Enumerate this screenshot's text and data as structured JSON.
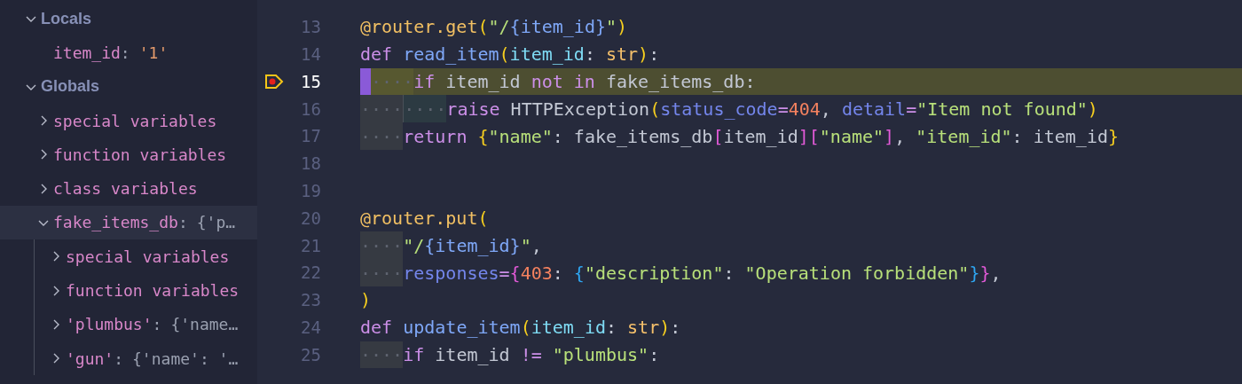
{
  "variables": [
    {
      "label": "Locals",
      "kind": "scope",
      "expanded": true,
      "selected": false,
      "children": [
        {
          "name": "item_id",
          "sep": ":",
          "value": "'1'",
          "kind": "leaf",
          "selected": false
        }
      ]
    },
    {
      "label": "Globals",
      "kind": "scope",
      "expanded": true,
      "selected": false,
      "children": [
        {
          "name": "special variables",
          "kind": "node",
          "expanded": false,
          "selected": false
        },
        {
          "name": "function variables",
          "kind": "node",
          "expanded": false,
          "selected": false
        },
        {
          "name": "class variables",
          "kind": "node",
          "expanded": false,
          "selected": false
        },
        {
          "name": "fake_items_db",
          "sep": ":",
          "value": "{'p…",
          "kind": "node",
          "expanded": true,
          "selected": true,
          "children": [
            {
              "name": "special variables",
              "kind": "node",
              "expanded": false,
              "selected": false
            },
            {
              "name": "function variables",
              "kind": "node",
              "expanded": false,
              "selected": false
            },
            {
              "name": "'plumbus'",
              "sep": ":",
              "value": "{'name…",
              "kind": "node",
              "expanded": false,
              "selected": false
            },
            {
              "name": "'gun'",
              "sep": ":",
              "value": "{'name': '…",
              "kind": "node",
              "expanded": false,
              "selected": false
            }
          ]
        }
      ]
    }
  ],
  "editor": {
    "lines": [
      {
        "number": "13",
        "current": false,
        "breakpoint": false,
        "tokens": [
          {
            "text": "@router.get",
            "kind": "deco"
          },
          {
            "text": "(",
            "kind": "paren"
          },
          {
            "text": "\"/",
            "kind": "str"
          },
          {
            "text": "{item_id}",
            "kind": "fn"
          },
          {
            "text": "\"",
            "kind": "str"
          },
          {
            "text": ")",
            "kind": "paren"
          }
        ]
      },
      {
        "number": "14",
        "current": false,
        "breakpoint": false,
        "tokens": [
          {
            "text": "def ",
            "kind": "kw"
          },
          {
            "text": "read_item",
            "kind": "fn"
          },
          {
            "text": "(",
            "kind": "paren"
          },
          {
            "text": "item_id",
            "kind": "param"
          },
          {
            "text": ": ",
            "kind": "plain"
          },
          {
            "text": "str",
            "kind": "type"
          },
          {
            "text": ")",
            "kind": "paren"
          },
          {
            "text": ":",
            "kind": "plain"
          }
        ]
      },
      {
        "number": "15",
        "current": true,
        "breakpoint": true,
        "tokens": [
          {
            "text": "····",
            "kind": "ws-mark"
          },
          {
            "text": "if ",
            "kind": "kw"
          },
          {
            "text": "item_id ",
            "kind": "plain"
          },
          {
            "text": "not in ",
            "kind": "kw"
          },
          {
            "text": "fake_items_db:",
            "kind": "plain"
          }
        ]
      },
      {
        "number": "16",
        "current": false,
        "breakpoint": false,
        "tokens": [
          {
            "text": "····",
            "kind": "ws"
          },
          {
            "text": "····",
            "kind": "ws2"
          },
          {
            "text": "raise ",
            "kind": "kw"
          },
          {
            "text": "HTTPException",
            "kind": "plain"
          },
          {
            "text": "(",
            "kind": "paren"
          },
          {
            "text": "status_code",
            "kind": "kwarg"
          },
          {
            "text": "=",
            "kind": "kw"
          },
          {
            "text": "404",
            "kind": "num"
          },
          {
            "text": ", ",
            "kind": "plain"
          },
          {
            "text": "detail",
            "kind": "kwarg"
          },
          {
            "text": "=",
            "kind": "kw"
          },
          {
            "text": "\"Item not found\"",
            "kind": "str"
          },
          {
            "text": ")",
            "kind": "paren"
          }
        ]
      },
      {
        "number": "17",
        "current": false,
        "breakpoint": false,
        "tokens": [
          {
            "text": "····",
            "kind": "ws"
          },
          {
            "text": "return ",
            "kind": "kw"
          },
          {
            "text": "{",
            "kind": "paren"
          },
          {
            "text": "\"name\"",
            "kind": "str"
          },
          {
            "text": ": fake_items_db",
            "kind": "plain"
          },
          {
            "text": "[",
            "kind": "bracket"
          },
          {
            "text": "item_id",
            "kind": "plain"
          },
          {
            "text": "][",
            "kind": "bracket"
          },
          {
            "text": "\"name\"",
            "kind": "str"
          },
          {
            "text": "]",
            "kind": "bracket"
          },
          {
            "text": ", ",
            "kind": "plain"
          },
          {
            "text": "\"item_id\"",
            "kind": "str"
          },
          {
            "text": ": item_id",
            "kind": "plain"
          },
          {
            "text": "}",
            "kind": "paren"
          }
        ]
      },
      {
        "number": "18",
        "current": false,
        "breakpoint": false
      },
      {
        "number": "19",
        "current": false,
        "breakpoint": false
      },
      {
        "number": "20",
        "current": false,
        "breakpoint": false,
        "tokens": [
          {
            "text": "@router.put",
            "kind": "deco"
          },
          {
            "text": "(",
            "kind": "paren"
          }
        ]
      },
      {
        "number": "21",
        "current": false,
        "breakpoint": false,
        "tokens": [
          {
            "text": "····",
            "kind": "ws"
          },
          {
            "text": "\"/",
            "kind": "str"
          },
          {
            "text": "{item_id}",
            "kind": "fn"
          },
          {
            "text": "\"",
            "kind": "str"
          },
          {
            "text": ",",
            "kind": "plain"
          }
        ]
      },
      {
        "number": "22",
        "current": false,
        "breakpoint": false,
        "tokens": [
          {
            "text": "····",
            "kind": "ws"
          },
          {
            "text": "responses",
            "kind": "kwarg"
          },
          {
            "text": "=",
            "kind": "kw"
          },
          {
            "text": "{",
            "kind": "bracket"
          },
          {
            "text": "403",
            "kind": "num"
          },
          {
            "text": ": ",
            "kind": "plain"
          },
          {
            "text": "{",
            "kind": "brace2"
          },
          {
            "text": "\"description\"",
            "kind": "str"
          },
          {
            "text": ": ",
            "kind": "plain"
          },
          {
            "text": "\"Operation forbidden\"",
            "kind": "str"
          },
          {
            "text": "}",
            "kind": "brace2"
          },
          {
            "text": "}",
            "kind": "bracket"
          },
          {
            "text": ",",
            "kind": "plain"
          }
        ]
      },
      {
        "number": "23",
        "current": false,
        "breakpoint": false,
        "tokens": [
          {
            "text": ")",
            "kind": "paren"
          }
        ]
      },
      {
        "number": "24",
        "current": false,
        "breakpoint": false,
        "tokens": [
          {
            "text": "def ",
            "kind": "kw"
          },
          {
            "text": "update_item",
            "kind": "fn"
          },
          {
            "text": "(",
            "kind": "paren"
          },
          {
            "text": "item_id",
            "kind": "param"
          },
          {
            "text": ": ",
            "kind": "plain"
          },
          {
            "text": "str",
            "kind": "type"
          },
          {
            "text": ")",
            "kind": "paren"
          },
          {
            "text": ":",
            "kind": "plain"
          }
        ]
      },
      {
        "number": "25",
        "current": false,
        "breakpoint": false,
        "tokens": [
          {
            "text": "····",
            "kind": "ws"
          },
          {
            "text": "if ",
            "kind": "kw"
          },
          {
            "text": "item_id ",
            "kind": "plain"
          },
          {
            "text": "!= ",
            "kind": "kw"
          },
          {
            "text": "\"plumbus\"",
            "kind": "str"
          },
          {
            "text": ":",
            "kind": "plain"
          }
        ]
      }
    ]
  }
}
